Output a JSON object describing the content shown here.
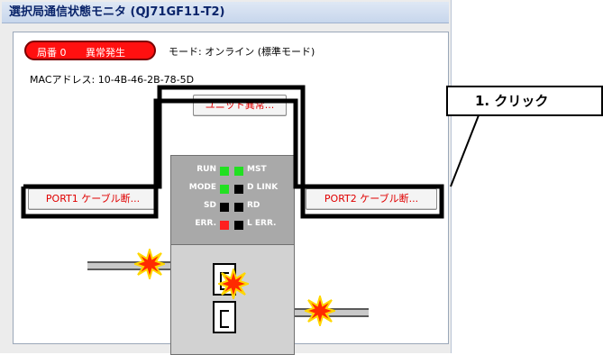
{
  "window": {
    "title": "選択局通信状態モニタ (QJ71GF11-T2)"
  },
  "status": {
    "station": "局番 0",
    "error": "異常発生",
    "mode": "モード:  オンライン (標準モード)",
    "mac": "MACアドレス: 10-4B-46-2B-78-5D"
  },
  "buttons": {
    "unit_error": "ユニット異常...",
    "port1": "PORT1 ケーブル断...",
    "port2": "PORT2 ケーブル断..."
  },
  "leds": {
    "run": "RUN",
    "mst": "MST",
    "mode": "MODE",
    "dlink": "D LINK",
    "sd": "SD",
    "rd": "RD",
    "err": "ERR.",
    "lerr": "L ERR.",
    "colors": {
      "on_green": "#22e022",
      "off": "#000000",
      "error_red": "#ff2020"
    }
  },
  "callout": {
    "text": "1. クリック"
  },
  "colors": {
    "highlight": "#000000",
    "burst_fill": "#ff2a00",
    "burst_outline": "#ffd700"
  }
}
